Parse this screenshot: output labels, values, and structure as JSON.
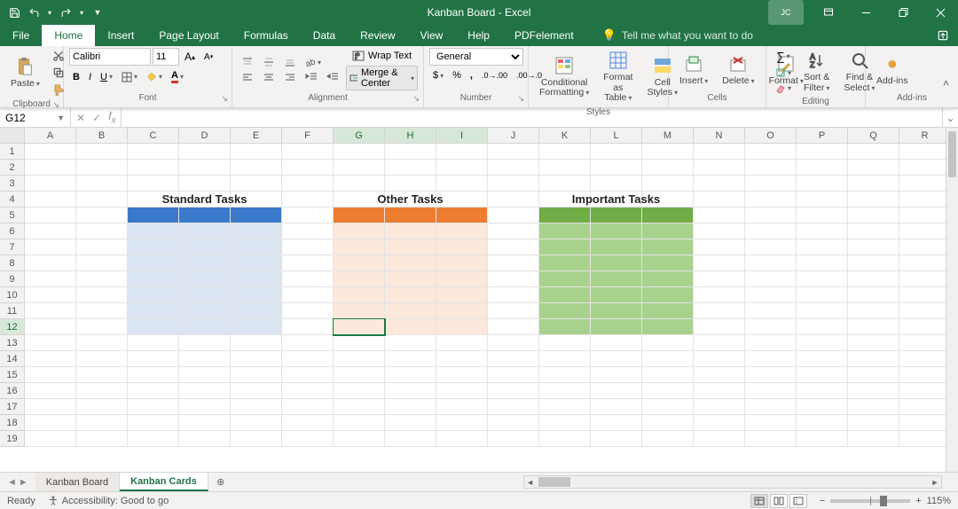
{
  "titlebar": {
    "title": "Kanban Board - Excel",
    "avatar": "JC"
  },
  "tabs": [
    "File",
    "Home",
    "Insert",
    "Page Layout",
    "Formulas",
    "Data",
    "Review",
    "View",
    "Help",
    "PDFelement"
  ],
  "active_tab_index": 1,
  "tellme": "Tell me what you want to do",
  "ribbon": {
    "clipboard": {
      "label": "Clipboard",
      "paste": "Paste"
    },
    "font": {
      "label": "Font",
      "name": "Calibri",
      "size": "11"
    },
    "alignment": {
      "label": "Alignment",
      "wrap": "Wrap Text",
      "merge": "Merge & Center"
    },
    "number": {
      "label": "Number",
      "format": "General"
    },
    "styles": {
      "label": "Styles",
      "cond": "Conditional Formatting",
      "table": "Format as Table",
      "cell": "Cell Styles"
    },
    "cells": {
      "label": "Cells",
      "insert": "Insert",
      "delete": "Delete",
      "format": "Format"
    },
    "editing": {
      "label": "Editing",
      "sort": "Sort & Filter",
      "find": "Find & Select"
    },
    "addins": {
      "label": "Add-ins",
      "btn": "Add-ins"
    }
  },
  "namebox": "G12",
  "columns": [
    "A",
    "B",
    "C",
    "D",
    "E",
    "F",
    "G",
    "H",
    "I",
    "J",
    "K",
    "L",
    "M",
    "N",
    "O",
    "P",
    "Q",
    "R"
  ],
  "rows": [
    "1",
    "2",
    "3",
    "4",
    "5",
    "6",
    "7",
    "8",
    "9",
    "10",
    "11",
    "12",
    "13",
    "14",
    "15",
    "16",
    "17",
    "18",
    "19"
  ],
  "selected_cols": [
    "G",
    "H",
    "I"
  ],
  "selected_row": "12",
  "cards": {
    "standard": {
      "title": "Standard Tasks"
    },
    "other": {
      "title": "Other Tasks"
    },
    "important": {
      "title": "Important Tasks"
    }
  },
  "sheets": {
    "list": [
      "Kanban Board",
      "Kanban Cards"
    ],
    "active_index": 1
  },
  "status": {
    "ready": "Ready",
    "accessibility": "Accessibility: Good to go",
    "zoom": "115%"
  }
}
